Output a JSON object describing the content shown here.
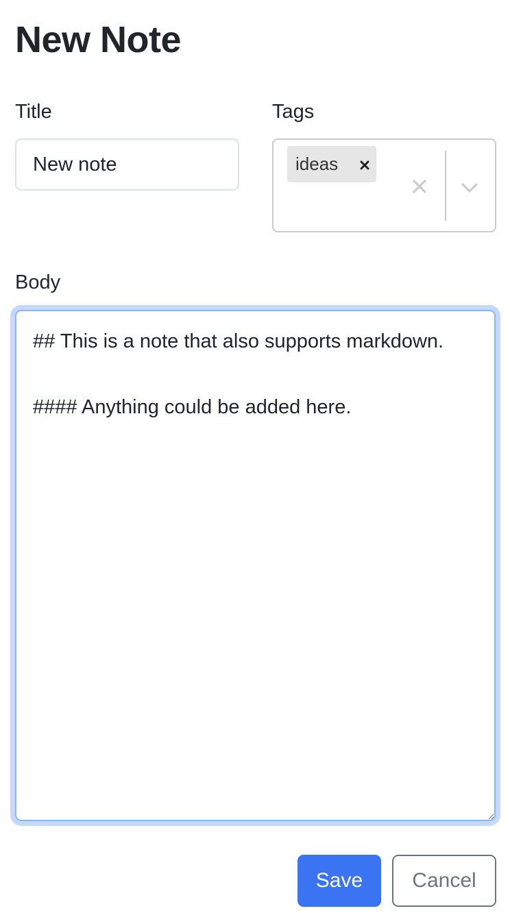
{
  "page": {
    "title": "New Note"
  },
  "form": {
    "title_label": "Title",
    "title_value": "New note",
    "tags_label": "Tags",
    "tags": [
      {
        "label": "ideas"
      }
    ],
    "body_label": "Body",
    "body_value": "## This is a note that also supports markdown.\n\n#### Anything could be added here."
  },
  "actions": {
    "save_label": "Save",
    "cancel_label": "Cancel"
  },
  "icons": {
    "tag_remove": "close-icon",
    "clear_all": "close-icon",
    "dropdown": "chevron-down-icon"
  },
  "colors": {
    "primary": "#3b74f2",
    "focus_border": "#86b7fe",
    "focus_ring": "#c6d8fc",
    "secondary": "#6c757d"
  }
}
